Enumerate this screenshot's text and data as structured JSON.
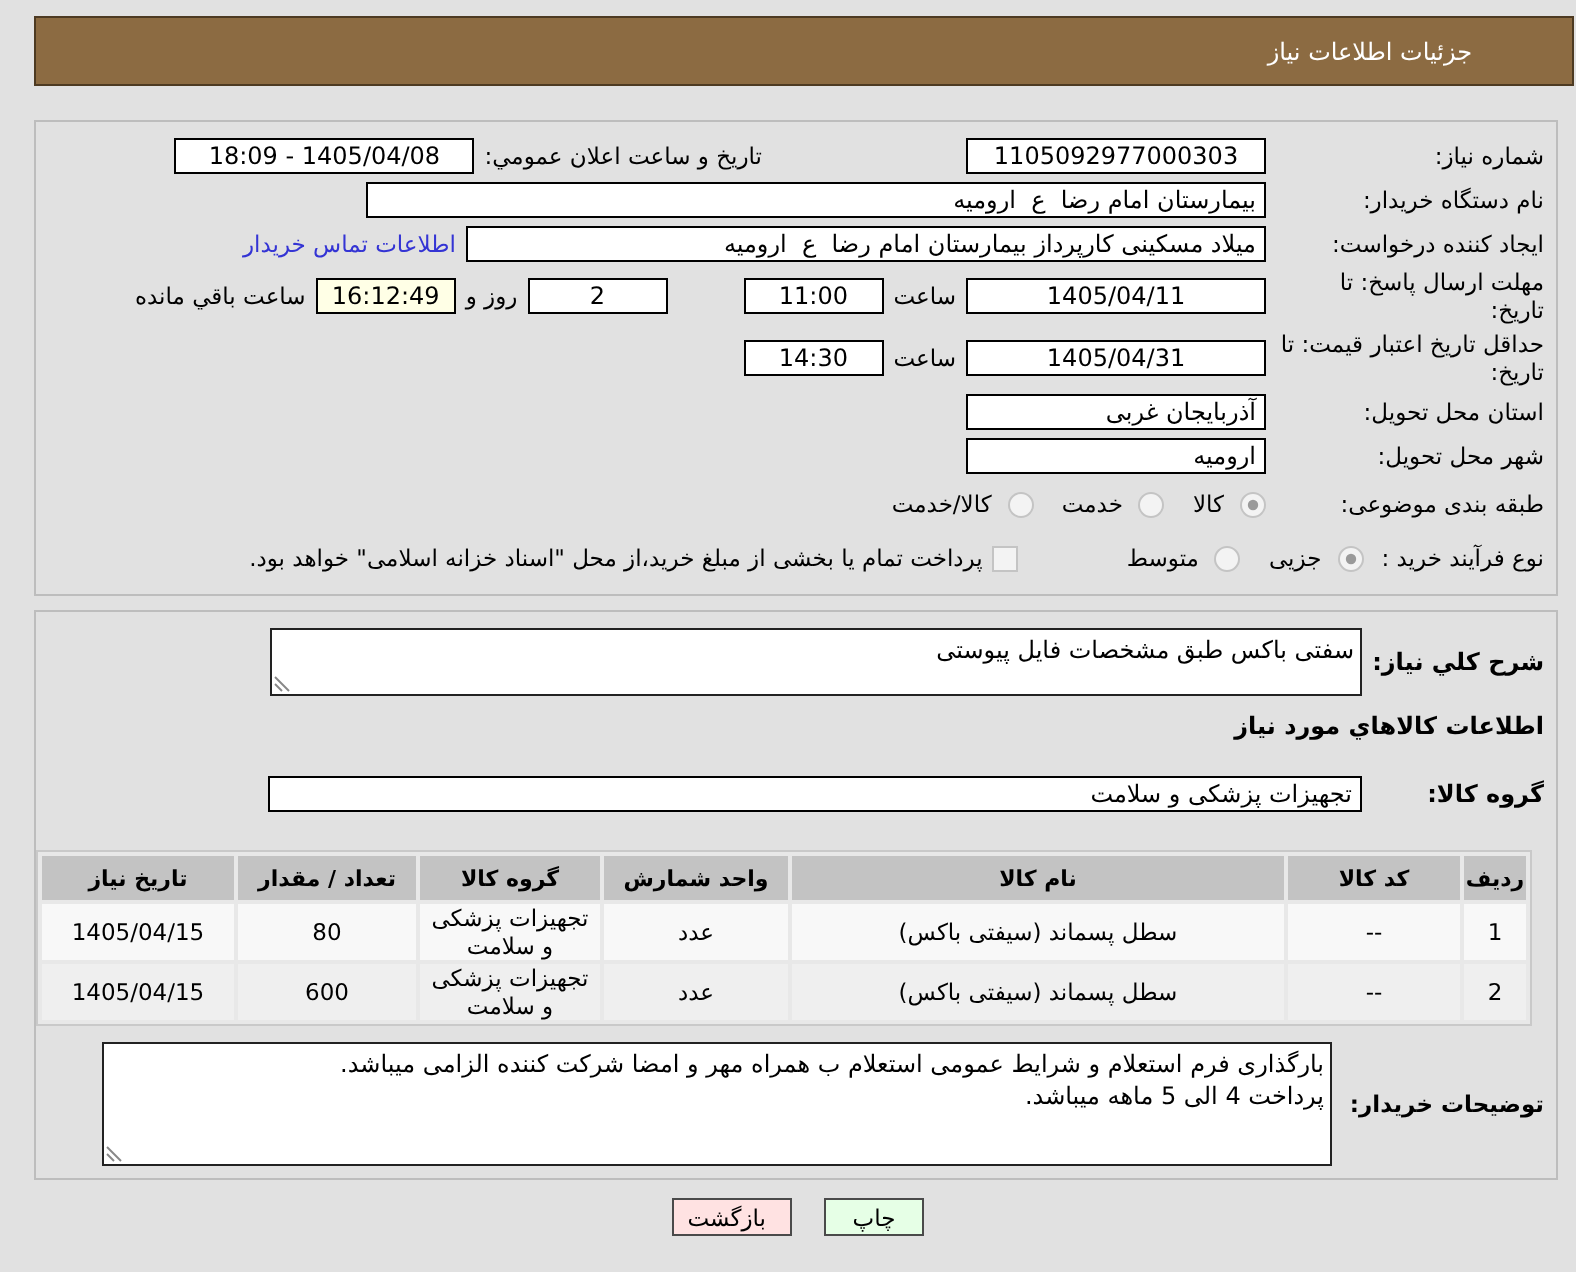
{
  "header": {
    "title": "جزئیات اطلاعات نیاز"
  },
  "summary": {
    "need_number": {
      "label": "شماره نیاز:",
      "value": "1105092977000303"
    },
    "announce_date": {
      "label": "تاریخ و ساعت اعلان عمومي:",
      "value": "1405/04/08 - 18:09"
    },
    "buyer_org": {
      "label": "نام دستگاه خریدار:",
      "value": "بیمارستان امام رضا  ع  ارومیه"
    },
    "requester": {
      "label": "ایجاد کننده درخواست:",
      "value": "میلاد مسکینی کارپرداز بیمارستان امام رضا  ع  ارومیه",
      "contact_link": "اطلاعات تماس خریدار"
    },
    "response_deadline": {
      "label": "مهلت ارسال پاسخ: تا تاریخ:",
      "date": "1405/04/11",
      "time_label": "ساعت",
      "time": "11:00",
      "days": "2",
      "days_label": "روز و",
      "remaining_time": "16:12:49",
      "remaining_label": "ساعت باقي مانده"
    },
    "price_validity": {
      "label": "حداقل تاریخ اعتبار قیمت: تا تاریخ:",
      "date": "1405/04/31",
      "time_label": "ساعت",
      "time": "14:30"
    },
    "province": {
      "label": "استان محل تحویل:",
      "value": "آذربایجان غربی"
    },
    "city": {
      "label": "شهر محل تحویل:",
      "value": "ارومیه"
    },
    "category": {
      "label": "طبقه بندی موضوعی:",
      "options": [
        {
          "label": "کالا",
          "selected": true
        },
        {
          "label": "خدمت",
          "selected": false
        },
        {
          "label": "کالا/خدمت",
          "selected": false
        }
      ]
    },
    "purchase_process": {
      "label": "نوع فرآیند خرید :",
      "options": [
        {
          "label": "جزیی",
          "selected": true
        },
        {
          "label": "متوسط",
          "selected": false
        }
      ],
      "treasury_payment": {
        "label": "پرداخت تمام یا بخشی از مبلغ خرید،از محل \"اسناد خزانه اسلامی\" خواهد بود.",
        "checked": false
      }
    }
  },
  "details": {
    "description": {
      "label": "شرح كلي نياز:",
      "value": "سفتی باکس طبق مشخصات فایل پیوستی"
    },
    "items_heading": "اطلاعات کالاهاي مورد نياز",
    "goods_group": {
      "label": "گروه کالا:",
      "value": "تجهیزات پزشکی و سلامت"
    },
    "items_table": {
      "columns": [
        "ردیف",
        "کد کالا",
        "نام کالا",
        "واحد شمارش",
        "گروه کالا",
        "تعداد / مقدار",
        "تاریخ نیاز"
      ],
      "rows": [
        [
          "1",
          "--",
          "سطل پسماند (سیفتی باکس)",
          "عدد",
          "تجهیزات پزشکی و سلامت",
          "80",
          "1405/04/15"
        ],
        [
          "2",
          "--",
          "سطل پسماند (سیفتی باکس)",
          "عدد",
          "تجهیزات پزشکی و سلامت",
          "600",
          "1405/04/15"
        ]
      ]
    },
    "buyer_notes": {
      "label": "توضیحات خریدار:",
      "lines": [
        "بارگذاری فرم استعلام و شرایط عمومی استعلام ب همراه مهر و امضا شرکت کننده الزامی میباشد.",
        "پرداخت 4 الی 5 ماهه میباشد."
      ]
    }
  },
  "buttons": [
    {
      "label": "چاپ",
      "kind": "print"
    },
    {
      "label": "بازگشت",
      "kind": "back"
    }
  ]
}
